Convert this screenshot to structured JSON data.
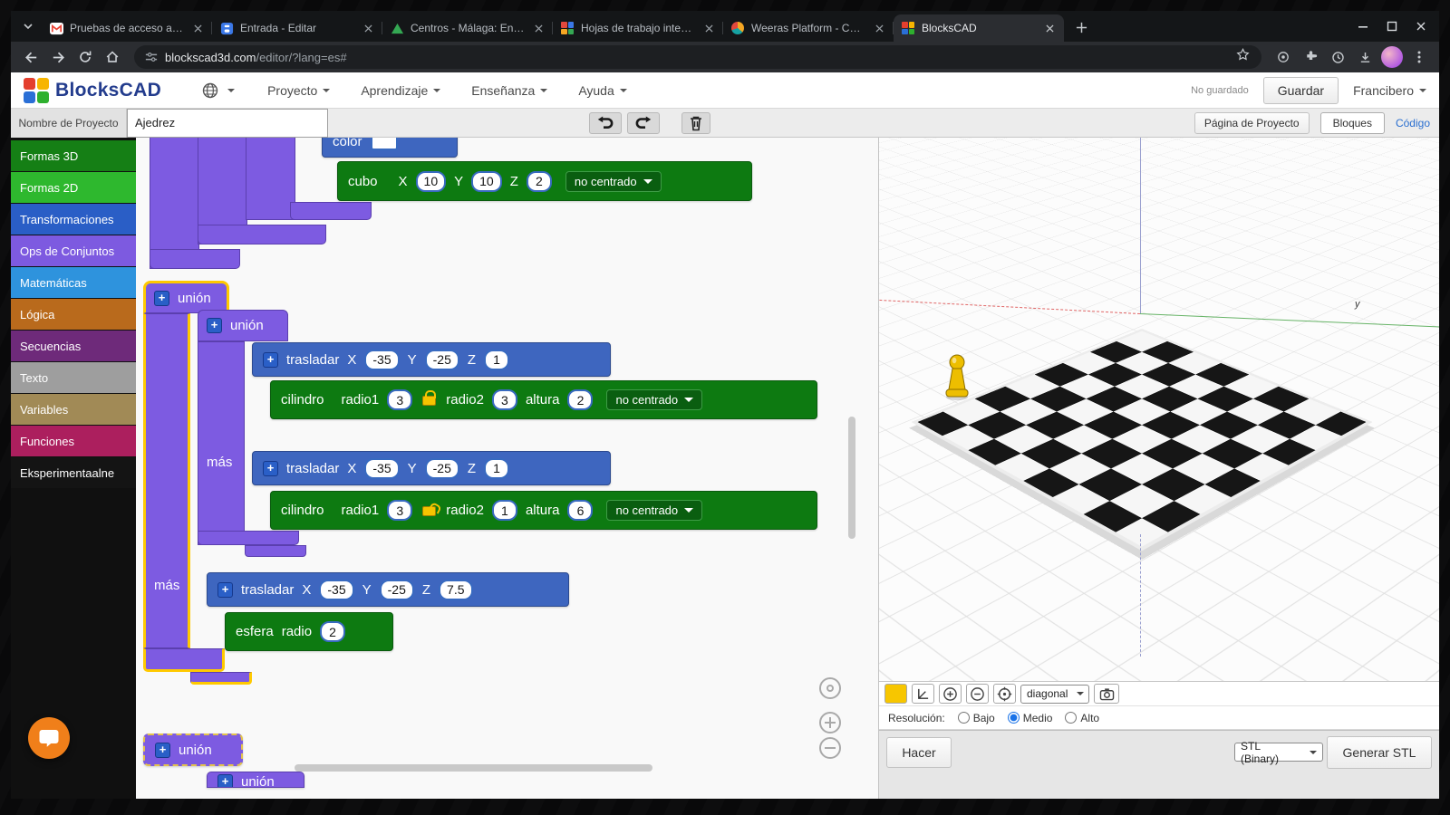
{
  "browser": {
    "tabs": [
      {
        "title": "Pruebas de acceso a la Unive"
      },
      {
        "title": "Entrada - Editar"
      },
      {
        "title": "Centros - Málaga: Entrar al s"
      },
      {
        "title": "Hojas de trabajo interactivas"
      },
      {
        "title": "Weeras Platform - Contenido"
      },
      {
        "title": "BlocksCAD"
      }
    ],
    "url": {
      "host": "blockscad3d.com",
      "path": "/editor/?lang=es#"
    }
  },
  "header": {
    "logo_text": "BlocksCAD",
    "menus": {
      "project": "Proyecto",
      "learn": "Aprendizaje",
      "teach": "Enseñanza",
      "help": "Ayuda"
    },
    "save_status": "No guardado",
    "save_button": "Guardar",
    "user_menu": "Francibero"
  },
  "project_bar": {
    "name_label": "Nombre de Proyecto",
    "name_value": "Ajedrez",
    "page_button": "Página de Proyecto",
    "blocks_tab": "Bloques",
    "code_tab": "Código"
  },
  "sidebar": {
    "categories": [
      {
        "label": "Formas 3D",
        "color": "#157f15"
      },
      {
        "label": "Formas 2D",
        "color": "#2eb82e"
      },
      {
        "label": "Transformaciones",
        "color": "#2a5ec6"
      },
      {
        "label": "Ops de Conjuntos",
        "color": "#7d5ae0"
      },
      {
        "label": "Matemáticas",
        "color": "#2e93dd"
      },
      {
        "label": "Lógica",
        "color": "#b96a1c"
      },
      {
        "label": "Secuencias",
        "color": "#6e2a7a"
      },
      {
        "label": "Texto",
        "color": "#9e9e9e"
      },
      {
        "label": "Variables",
        "color": "#a18a56"
      },
      {
        "label": "Funciones",
        "color": "#ac1f5e"
      },
      {
        "label": "Eksperimentaalne",
        "color": "#141414"
      }
    ]
  },
  "workspace": {
    "plus": "+",
    "union_label": "unión",
    "more_label": "más",
    "color_block": {
      "label": "color"
    },
    "cube": {
      "label": "cubo",
      "x_label": "X",
      "x": "10",
      "y_label": "Y",
      "y": "10",
      "z_label": "Z",
      "z": "2",
      "centered": "no centrado"
    },
    "translate1": {
      "label": "trasladar",
      "x_label": "X",
      "x": "-35",
      "y_label": "Y",
      "y": "-25",
      "z_label": "Z",
      "z": "1"
    },
    "cylinder1": {
      "label": "cilindro",
      "r1_label": "radio1",
      "r1": "3",
      "r2_label": "radio2",
      "r2": "3",
      "h_label": "altura",
      "h": "2",
      "centered": "no centrado",
      "lock": "closed"
    },
    "translate2": {
      "label": "trasladar",
      "x_label": "X",
      "x": "-35",
      "y_label": "Y",
      "y": "-25",
      "z_label": "Z",
      "z": "1"
    },
    "cylinder2": {
      "label": "cilindro",
      "r1_label": "radio1",
      "r1": "3",
      "r2_label": "radio2",
      "r2": "1",
      "h_label": "altura",
      "h": "6",
      "centered": "no centrado",
      "lock": "open"
    },
    "translate3": {
      "label": "trasladar",
      "x_label": "X",
      "x": "-35",
      "y_label": "Y",
      "y": "-25",
      "z_label": "Z",
      "z": "7.5"
    },
    "sphere": {
      "label": "esfera",
      "r_label": "radio",
      "r": "2"
    },
    "bottom_union1": "unión",
    "bottom_union2": "unión"
  },
  "viewport": {
    "view_selected": "diagonal",
    "resolution_label": "Resolución:",
    "resolution_options": [
      "Bajo",
      "Medio",
      "Alto"
    ],
    "resolution_selected": "Medio",
    "render_button": "Hacer",
    "stl_format": "STL (Binary)",
    "generate_button": "Generar STL",
    "axis_y_label": "y",
    "board": {
      "rows": 8,
      "cols": 8,
      "dark_color": "#161616",
      "light_color": "#f6f6f6"
    },
    "pawn_color": "#edbe00"
  }
}
